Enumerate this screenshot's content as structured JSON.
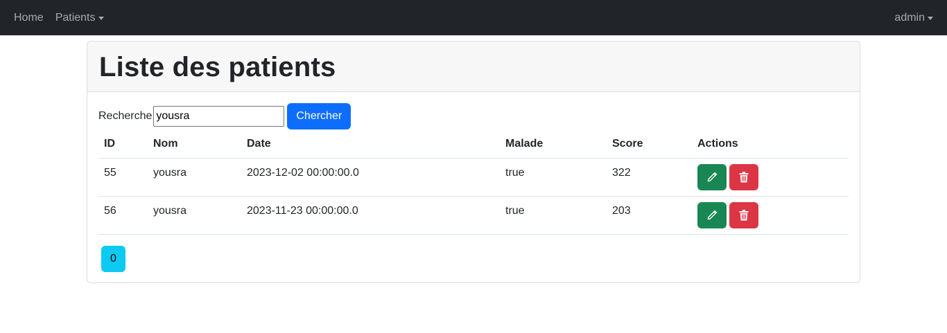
{
  "navbar": {
    "home_label": "Home",
    "patients_label": "Patients",
    "user_label": "admin"
  },
  "page": {
    "title": "Liste des patients"
  },
  "search": {
    "label": "Recherche",
    "value": "yousra",
    "button_label": "Chercher"
  },
  "table": {
    "headers": [
      "ID",
      "Nom",
      "Date",
      "Malade",
      "Score",
      "Actions"
    ],
    "rows": [
      {
        "id": "55",
        "nom": "yousra",
        "date": "2023-12-02 00:00:00.0",
        "malade": "true",
        "score": "322"
      },
      {
        "id": "56",
        "nom": "yousra",
        "date": "2023-11-23 00:00:00.0",
        "malade": "true",
        "score": "203"
      }
    ]
  },
  "pagination": {
    "pages": [
      "0"
    ]
  },
  "colors": {
    "navbar": "#212529",
    "primary": "#0d6efd",
    "success": "#198754",
    "danger": "#dc3545",
    "info": "#0dcaf0"
  },
  "icons": {
    "edit": "pencil-icon",
    "delete": "trash-icon"
  }
}
